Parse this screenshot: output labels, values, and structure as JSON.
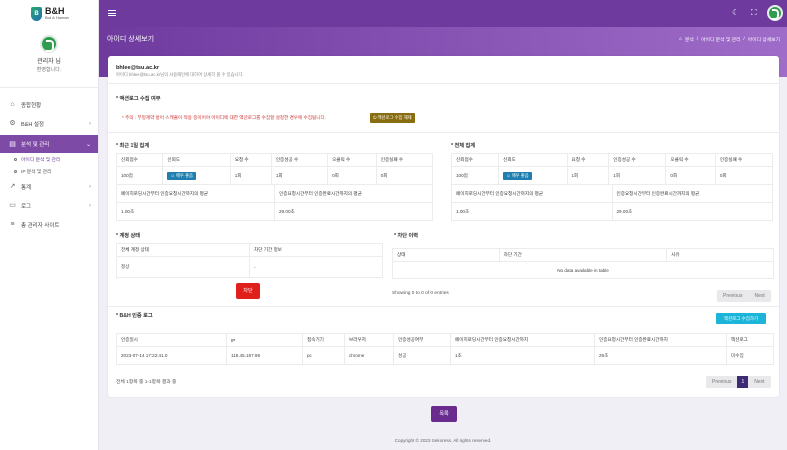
{
  "brand": {
    "title": "B&H",
    "subtitle": "Bot & Human",
    "shield_text": "B"
  },
  "profile": {
    "name": "관리자 님",
    "welcome": "환영합니다."
  },
  "menu": [
    {
      "label": "종합현황",
      "icon": "home-icon"
    },
    {
      "label": "B&H 설정",
      "icon": "gear-icon"
    },
    {
      "label": "분석 및 관리",
      "icon": "chart-icon"
    },
    {
      "label": "아이디 분석 및 관리"
    },
    {
      "label": "IP 분석 및 관리"
    },
    {
      "label": "통계",
      "icon": "stats-icon"
    },
    {
      "label": "로그",
      "icon": "doc-icon"
    },
    {
      "label": "총 관리자 사이트",
      "icon": "list-icon"
    }
  ],
  "header": {
    "title": "아이디 상세보기",
    "breadcrumb": [
      "분석",
      "아이디 분석 및 관리",
      "아이디 상세보기"
    ]
  },
  "user": {
    "email": "bhlee@tsu.ac.kr",
    "subtitle": "아이디 bhlee@tsu.ac.kr님의 사용패턴에 대하여 상세히 볼 수 있습니다."
  },
  "actionlog": {
    "title": "액션로그 수집 여부",
    "warning": "* 주의 : 부정계약 방어 스케줄이 적용 중이어야 아이디에 대한 액션로그를 수집할 설정한 경우에 수집됩니다.",
    "button": "액션로그 수집 해제"
  },
  "recent": {
    "title": "최근 1일 집계",
    "headers": [
      "신뢰점수",
      "신뢰도",
      "요청 수",
      "인증성공 수",
      "오클릭 수",
      "인증실패 수"
    ],
    "row": [
      "100점",
      "매우 좋음",
      "1회",
      "1회",
      "0회",
      "0회"
    ],
    "sub_headers": [
      "페이지로딩시간부터 인증요청시간까지의 평균",
      "인증요청시간부터 인증완료시간까지의 평균"
    ],
    "sub_row": [
      "1.00초",
      "29.00초"
    ]
  },
  "total": {
    "title": "전체 집계",
    "headers": [
      "신뢰점수",
      "신뢰도",
      "요청 수",
      "인증성공 수",
      "오클릭 수",
      "인증실패 수"
    ],
    "row": [
      "100점",
      "매우 좋음",
      "1회",
      "1회",
      "0회",
      "0회"
    ],
    "sub_headers": [
      "페이지로딩시간부터 인증요청시간까지의 평균",
      "인증요청시간부터 인증완료시간까지의 평균"
    ],
    "sub_row": [
      "1.00초",
      "29.00초"
    ]
  },
  "account": {
    "title": "계정 상태",
    "headers": [
      "전체 계정 상태",
      "차단 기간 정보"
    ],
    "row": [
      "정상",
      "-"
    ],
    "stop_button": "차단"
  },
  "block": {
    "title": "차단 이력",
    "headers": [
      "상태",
      "차단 기간",
      "사유"
    ],
    "empty": "No data available in table",
    "showing": "Showing 0 to 0 of 0 entries",
    "prev": "Previous",
    "next": "Next"
  },
  "authlog": {
    "title": "B&H 인증 로그",
    "button": "액션로그 수집하기",
    "headers": [
      "인증일시",
      "IP",
      "접속기기",
      "브라우저",
      "인증성공여부",
      "페이지로딩시간부터 인증요청시간까지",
      "인증요청시간부터 인증완료시간까지",
      "액션로그"
    ],
    "row": [
      "2023-07-14 17:22:41.0",
      "118.45.187.98",
      "pc",
      "chrome",
      "성공",
      "1초",
      "29초",
      "미수집"
    ],
    "showing": "전체 1항목 중 1-1항목 결과 중",
    "prev": "Previous",
    "page": "1",
    "next": "Next"
  },
  "list_button": "목록",
  "footer": "Copyright © 2023 Sekoress. All rights reserved."
}
